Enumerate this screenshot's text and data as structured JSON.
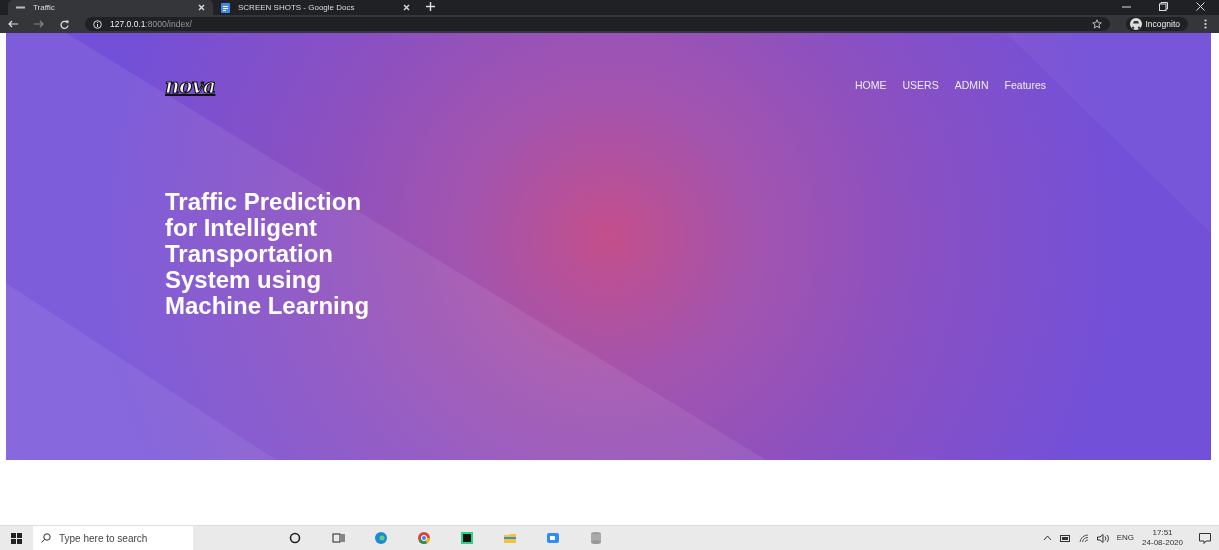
{
  "browser": {
    "tabs": [
      {
        "title": "Traffic",
        "selected": true
      },
      {
        "title": "SCREEN SHOTS - Google Docs",
        "selected": false
      }
    ],
    "address": {
      "host": "127.0.0.1",
      "rest": ":8000/index/"
    },
    "profile": "Incognito"
  },
  "page": {
    "brand": "nova",
    "nav": [
      "HOME",
      "USERS",
      "ADMIN",
      "Features"
    ],
    "headline": "Traffic Prediction for Intelligent Transportation System using Machine Learning"
  },
  "taskbar": {
    "search_placeholder": "Type here to search",
    "language": "ENG",
    "time": "17:51",
    "date": "24-08-2020"
  }
}
